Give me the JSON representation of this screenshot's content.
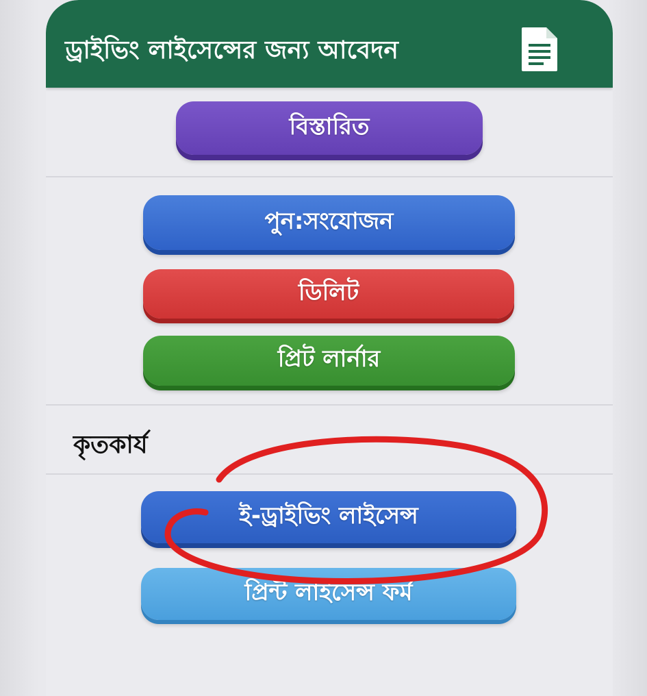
{
  "header": {
    "title": "ড্রাইভিং লাইসেন্সের জন্য আবেদন",
    "icon": "document-icon",
    "color": "#1e6b4a"
  },
  "buttons": {
    "details": "বিস্তারিত",
    "reconnect": "পুন:সংযোজন",
    "delete": "ডিলিট",
    "print_learner": "প্রিট লার্নার",
    "e_driving_license": "ই-ড্রাইভিং লাইসেন্স",
    "print_license_form": "প্রিন্ট লাইসেন্স ফর্ম"
  },
  "section": {
    "label": "কৃতকার্য"
  },
  "annotation": {
    "color": "#e02020"
  }
}
